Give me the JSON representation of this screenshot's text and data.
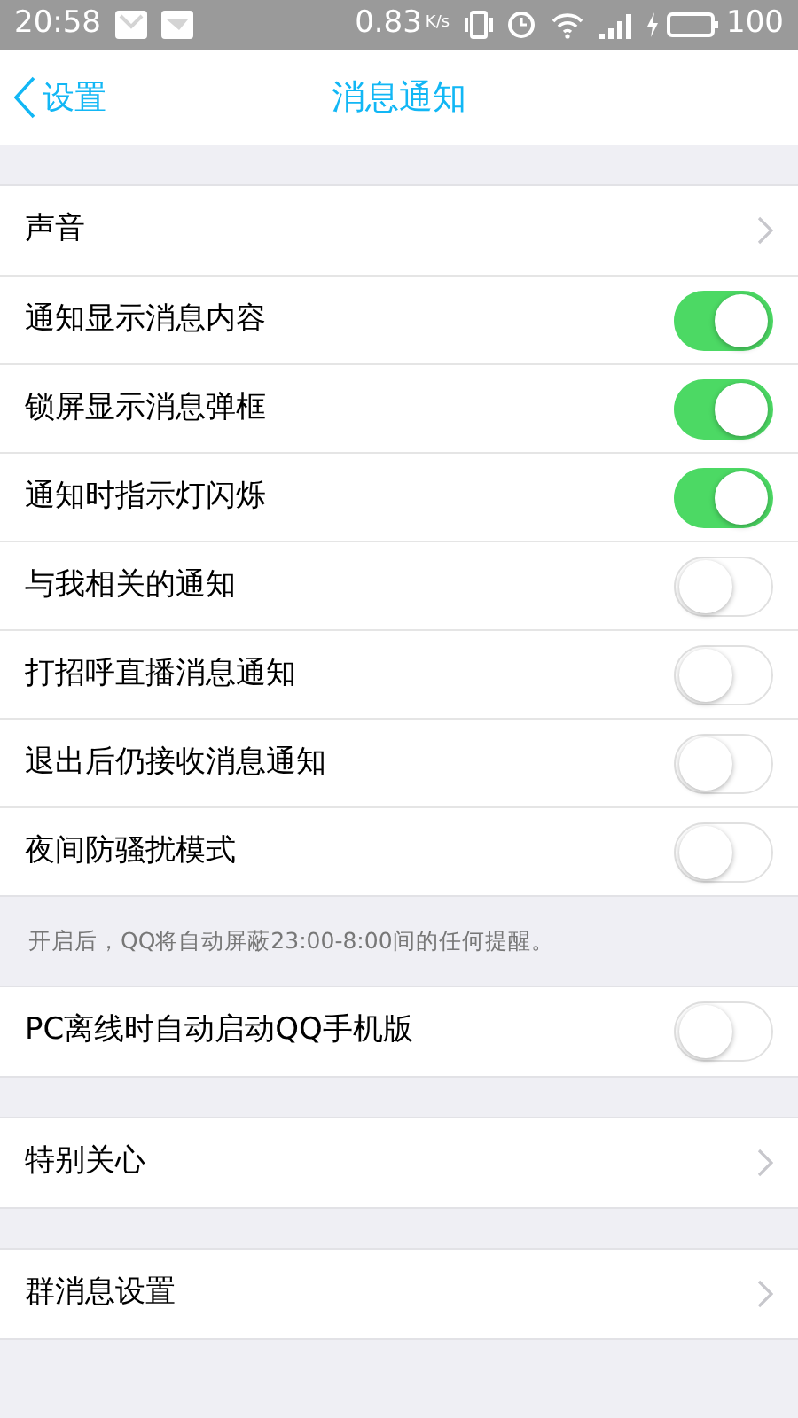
{
  "status_bar": {
    "time": "20:58",
    "speed": "0.83",
    "speed_unit": "K/s",
    "battery": "100"
  },
  "nav": {
    "back": "设置",
    "title": "消息通知"
  },
  "groups": [
    {
      "rows": [
        {
          "kind": "arrow",
          "label": "声音"
        },
        {
          "kind": "toggle",
          "label": "通知显示消息内容",
          "on": true
        },
        {
          "kind": "toggle",
          "label": "锁屏显示消息弹框",
          "on": true
        },
        {
          "kind": "toggle",
          "label": "通知时指示灯闪烁",
          "on": true
        },
        {
          "kind": "toggle",
          "label": "与我相关的通知",
          "on": false
        },
        {
          "kind": "toggle",
          "label": "打招呼直播消息通知",
          "on": false
        },
        {
          "kind": "toggle",
          "label": "退出后仍接收消息通知",
          "on": false
        },
        {
          "kind": "toggle",
          "label": "夜间防骚扰模式",
          "on": false
        }
      ],
      "note": "开启后，QQ将自动屏蔽23:00-8:00间的任何提醒。"
    },
    {
      "rows": [
        {
          "kind": "toggle",
          "label": "PC离线时自动启动QQ手机版",
          "on": false
        }
      ]
    },
    {
      "rows": [
        {
          "kind": "arrow",
          "label": "特别关心"
        }
      ]
    },
    {
      "rows": [
        {
          "kind": "arrow",
          "label": "群消息设置"
        }
      ]
    }
  ]
}
